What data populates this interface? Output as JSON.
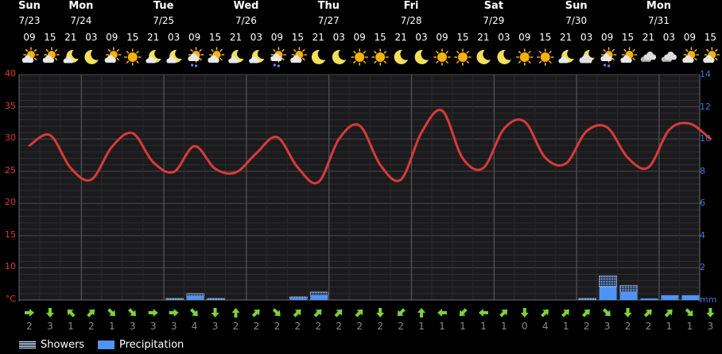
{
  "days": [
    {
      "name": "Sun",
      "date": "7/23"
    },
    {
      "name": "Mon",
      "date": "7/24"
    },
    {
      "name": "Tue",
      "date": "7/25"
    },
    {
      "name": "Wed",
      "date": "7/26"
    },
    {
      "name": "Thu",
      "date": "7/27"
    },
    {
      "name": "Fri",
      "date": "7/28"
    },
    {
      "name": "Sat",
      "date": "7/29"
    },
    {
      "name": "Sun",
      "date": "7/30"
    },
    {
      "name": "Mon",
      "date": "7/31"
    }
  ],
  "hours": [
    "09",
    "15",
    "21",
    "03",
    "09",
    "15",
    "21",
    "03",
    "09",
    "15",
    "21",
    "03",
    "09",
    "15",
    "21",
    "03",
    "09",
    "15",
    "21",
    "03",
    "09",
    "15",
    "21",
    "03",
    "09",
    "15",
    "21",
    "03",
    "09",
    "15",
    "21",
    "03",
    "09",
    "15"
  ],
  "icons": [
    "sun-cloud-icon",
    "sun-cloud-icon",
    "moon-cloud-icon",
    "moon-icon",
    "sun-cloud-icon",
    "sun-icon",
    "moon-cloud-icon",
    "moon-cloud-icon",
    "sun-shower-icon",
    "sun-cloud-icon",
    "moon-cloud-icon",
    "moon-cloud-icon",
    "sun-shower-icon",
    "sun-cloud-icon",
    "moon-icon",
    "moon-icon",
    "sun-icon",
    "sun-icon",
    "moon-icon",
    "moon-icon",
    "sun-icon",
    "sun-icon",
    "moon-icon",
    "moon-icon",
    "sun-icon",
    "sun-icon",
    "moon-cloud-icon",
    "cloud-moon-icon",
    "sun-shower-icon",
    "sun-cloud-icon",
    "cloud-icon",
    "cloud-icon",
    "sun-cloud-icon",
    "sun-cloud-icon"
  ],
  "wind_directions_deg": [
    90,
    180,
    315,
    45,
    135,
    135,
    90,
    90,
    135,
    180,
    0,
    45,
    135,
    45,
    45,
    45,
    45,
    180,
    225,
    0,
    270,
    225,
    270,
    45,
    180,
    45,
    45,
    45,
    135,
    180,
    45,
    45,
    135,
    180
  ],
  "wind_speeds": [
    "2",
    "3",
    "1",
    "2",
    "1",
    "3",
    "3",
    "3",
    "4",
    "3",
    "2",
    "2",
    "2",
    "2",
    "2",
    "2",
    "2",
    "2",
    "2",
    "1",
    "1",
    "1",
    "1",
    "1",
    "0",
    "4",
    "1",
    "2",
    "3",
    "2",
    "2",
    "1",
    "1",
    "3"
  ],
  "legend": {
    "showers": "Showers",
    "precipitation": "Precipitation"
  },
  "colors": {
    "temperature": "#d93a3a",
    "precipitation": "#4f93f5",
    "axis_left": "#d93a3a",
    "axis_right": "#3a7bdc",
    "sun": "#f5b10c",
    "moon": "#f3e05a"
  },
  "chart_data": {
    "type": "line",
    "x": [
      "7/23 09",
      "7/23 15",
      "7/23 21",
      "7/24 03",
      "7/24 09",
      "7/24 15",
      "7/24 21",
      "7/25 03",
      "7/25 09",
      "7/25 15",
      "7/25 21",
      "7/26 03",
      "7/26 09",
      "7/26 15",
      "7/26 21",
      "7/27 03",
      "7/27 09",
      "7/27 15",
      "7/27 21",
      "7/28 03",
      "7/28 09",
      "7/28 15",
      "7/28 21",
      "7/29 03",
      "7/29 09",
      "7/29 15",
      "7/29 21",
      "7/30 03",
      "7/30 09",
      "7/30 15",
      "7/30 21",
      "7/31 03",
      "7/31 09",
      "7/31 15"
    ],
    "series": [
      {
        "values": [
          29.0,
          30.6,
          25.5,
          23.7,
          28.8,
          30.9,
          26.4,
          24.9,
          28.9,
          25.4,
          24.8,
          27.8,
          30.3,
          25.6,
          23.3,
          30.0,
          32.1,
          26.0,
          23.7,
          31.0,
          34.4,
          27.0,
          25.5,
          31.6,
          32.7,
          27.1,
          26.2,
          31.2,
          31.8,
          27.1,
          25.6,
          31.4,
          32.4,
          30.0
        ]
      }
    ],
    "precipitation": {
      "showers": [
        0,
        0,
        0,
        0,
        0,
        0,
        0,
        0.1,
        0.4,
        0.1,
        0,
        0,
        0,
        0.2,
        0.5,
        0,
        0,
        0,
        0,
        0,
        0,
        0,
        0,
        0,
        0,
        0,
        0,
        0.1,
        1.5,
        0.9,
        0,
        0,
        0,
        0
      ],
      "total": [
        0,
        0,
        0,
        0,
        0,
        0,
        0,
        0.1,
        0.4,
        0.1,
        0,
        0,
        0,
        0.2,
        0.5,
        0,
        0,
        0,
        0,
        0,
        0,
        0,
        0,
        0,
        0,
        0,
        0,
        0.1,
        1.5,
        0.9,
        0.1,
        0.3,
        0.3,
        0
      ]
    },
    "y_left": {
      "unit": "°C",
      "ticks": [
        "40",
        "35",
        "30",
        "25",
        "20",
        "15",
        "10"
      ],
      "ylim": [
        5,
        40
      ]
    },
    "y_right": {
      "unit": "mm",
      "ticks": [
        "14",
        "12",
        "10",
        "8",
        "6",
        "4",
        "2"
      ],
      "ylim": [
        0,
        14
      ]
    },
    "grid": true
  }
}
